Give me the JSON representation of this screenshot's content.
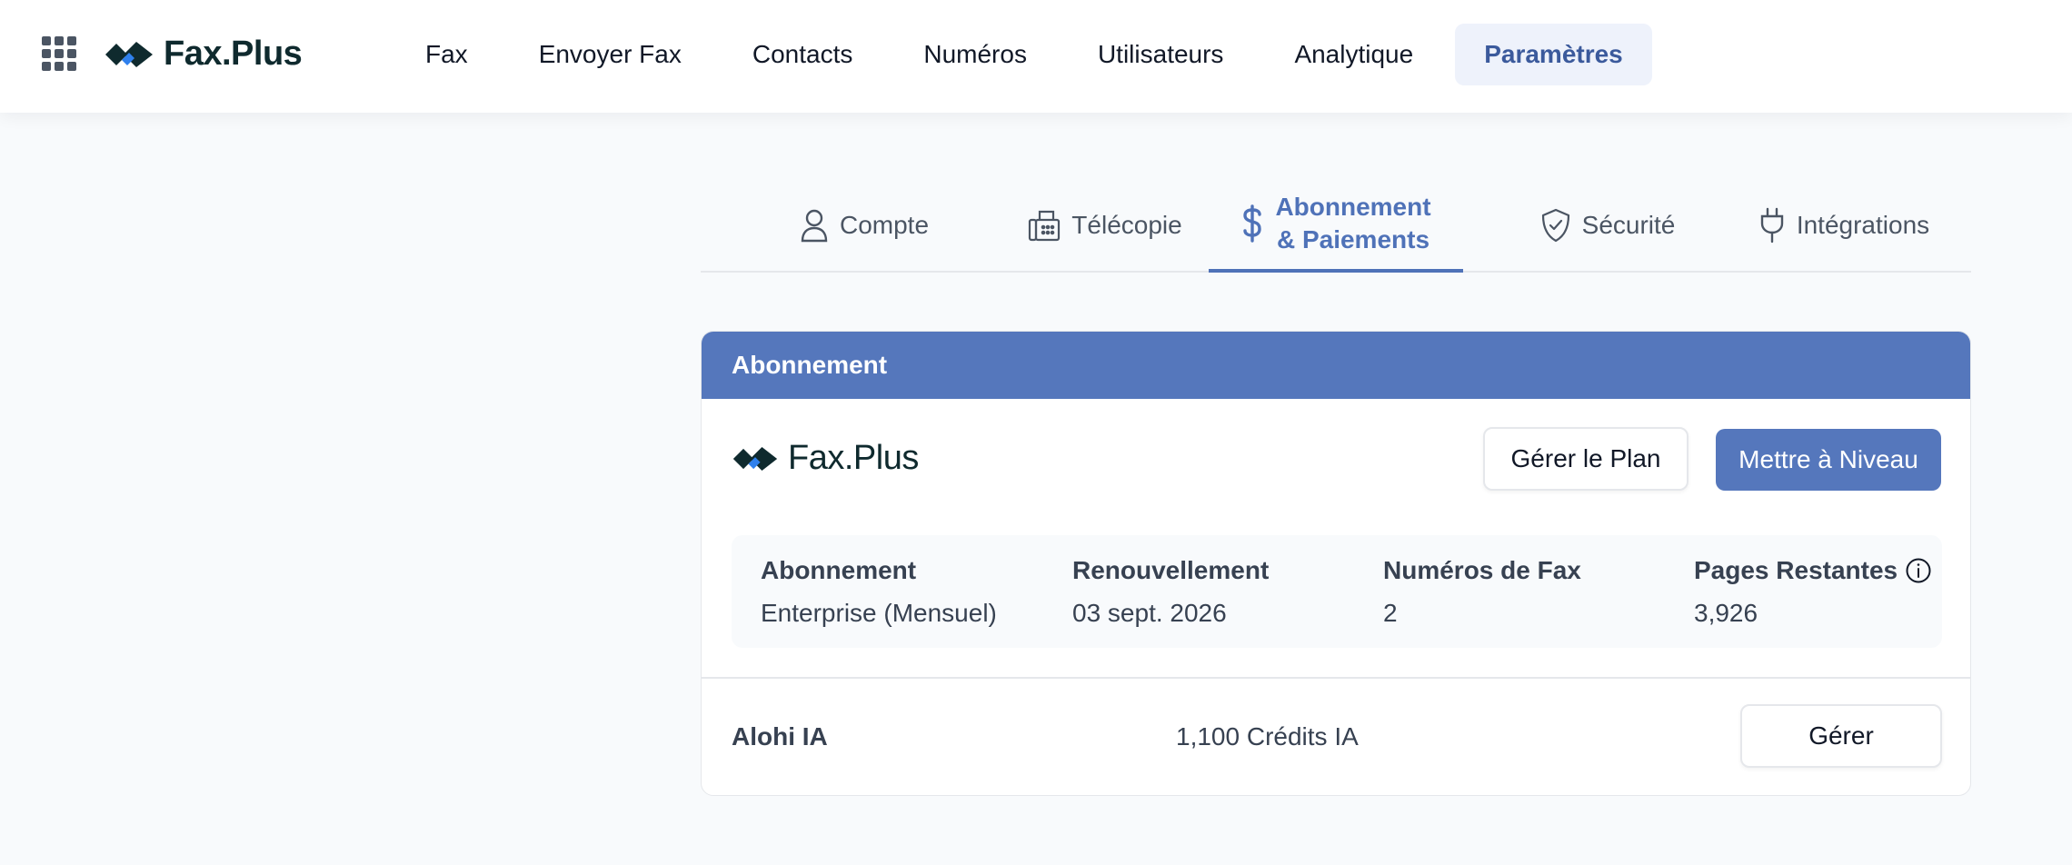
{
  "app": {
    "brand": "Fax.Plus"
  },
  "nav": {
    "items": [
      "Fax",
      "Envoyer Fax",
      "Contacts",
      "Numéros",
      "Utilisateurs",
      "Analytique",
      "Paramètres"
    ],
    "active_index": 6
  },
  "tabs": {
    "compte": "Compte",
    "telecopie": "Télécopie",
    "abonnement_line1": "Abonnement",
    "abonnement_line2": "& Paiements",
    "securite": "Sécurité",
    "integrations": "Intégrations"
  },
  "card": {
    "header": "Abonnement",
    "brand": "Fax.Plus",
    "manage_plan_label": "Gérer le Plan",
    "upgrade_label": "Mettre à Niveau",
    "stats": [
      {
        "label": "Abonnement",
        "value": "Enterprise (Mensuel)"
      },
      {
        "label": "Renouvellement",
        "value": "03 sept. 2026"
      },
      {
        "label": "Numéros de Fax",
        "value": "2"
      },
      {
        "label": "Pages Restantes",
        "value": "3,926"
      }
    ],
    "ai": {
      "label": "Alohi IA",
      "credits": "1,100 Crédits IA",
      "manage_label": "Gérer"
    }
  },
  "colors": {
    "accent": "#5577bc",
    "active_tab": "#4f72b8",
    "brand_dark": "#0f2a2e",
    "brand_blue": "#2f80ed"
  },
  "icons": {
    "apps": "grid-icon",
    "logo": "faxplus-logo-icon",
    "compte": "user-icon",
    "telecopie": "fax-machine-icon",
    "abonnement": "dollar-icon",
    "securite": "shield-check-icon",
    "integrations": "plug-icon",
    "info": "info-icon"
  }
}
